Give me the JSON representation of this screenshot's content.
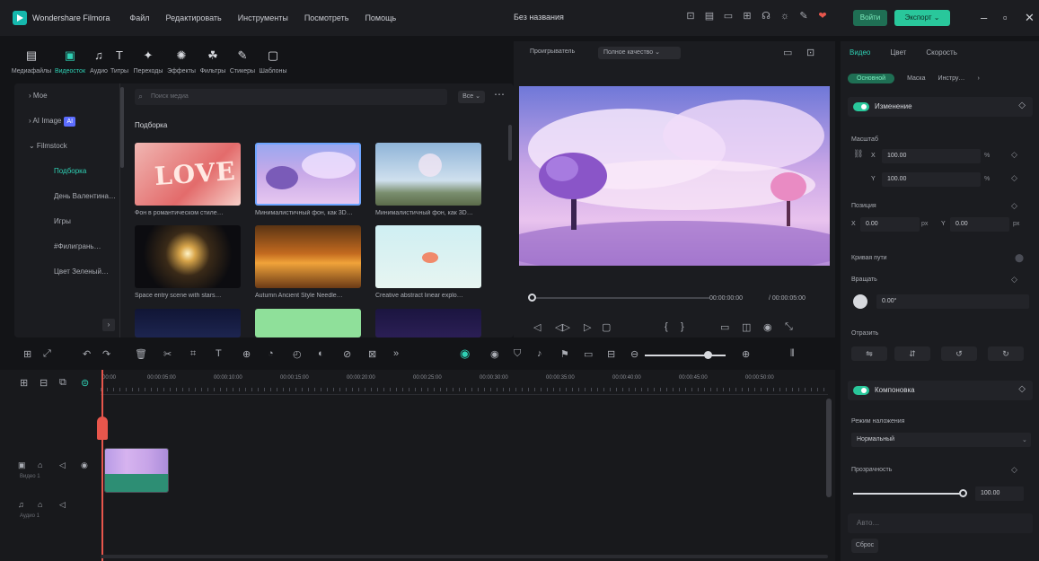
{
  "app": {
    "name": "Wondershare Filmora",
    "menu": [
      "Файл",
      "Редактировать",
      "Инструменты",
      "Посмотреть",
      "Помощь"
    ],
    "project_title": "Без названия",
    "login_label": "Войти",
    "export_label": "Экспорт ⌄",
    "toolbar_icons": [
      "monitor-icon",
      "save-icon",
      "screen-icon",
      "grid-icon",
      "headset-icon",
      "bulb-icon",
      "notes-icon"
    ],
    "window_controls": [
      "minimize-icon",
      "maximize-icon",
      "close-icon"
    ]
  },
  "library": {
    "tools": [
      {
        "icon": "▤",
        "name": "media",
        "label": "Медиафайлы"
      },
      {
        "icon": "▣",
        "name": "stock",
        "label": "Видеосток"
      },
      {
        "icon": "♫",
        "name": "audio",
        "label": "Аудио"
      },
      {
        "icon": "T",
        "name": "titles",
        "label": "Титры"
      },
      {
        "icon": "✦",
        "name": "transitions",
        "label": "Переходы"
      },
      {
        "icon": "✺",
        "name": "effects",
        "label": "Эффекты"
      },
      {
        "icon": "☘",
        "name": "filters",
        "label": "Фильтры"
      },
      {
        "icon": "✎",
        "name": "stickers",
        "label": "Стикеры"
      },
      {
        "icon": "▢",
        "name": "templates",
        "label": "Шаблоны"
      }
    ],
    "sidebar": [
      {
        "label": "› Мое",
        "kind": "top"
      },
      {
        "label": "› AI Image",
        "badge": "AI",
        "kind": "top"
      },
      {
        "label": "⌄ Filmstock",
        "kind": "top"
      },
      {
        "label": "Подборка",
        "kind": "active"
      },
      {
        "label": "День Валентина…",
        "kind": "sub"
      },
      {
        "label": "Игры",
        "kind": "sub"
      },
      {
        "label": "#Филигрань…",
        "kind": "sub"
      },
      {
        "label": "Цвет Зеленый…",
        "kind": "sub"
      }
    ],
    "search_placeholder": "Поиск медиа",
    "filter_label": "Все ⌄",
    "section_title": "Подборка",
    "thumbs": [
      {
        "caption": "Фон в романтическом стиле…"
      },
      {
        "caption": "Минималистичный фон, как 3D…"
      },
      {
        "caption": "Минималистичный фон, как 3D…"
      },
      {
        "caption": "Space entry scene with stars…"
      },
      {
        "caption": "Autumn Ancient Style Needle…"
      },
      {
        "caption": "Creative abstract linear explo…"
      },
      {
        "caption": ""
      },
      {
        "caption": ""
      },
      {
        "caption": ""
      }
    ]
  },
  "player": {
    "label": "Проигрыватель",
    "quality": "Полное качество ⌄",
    "time_current": "00:00:00:00",
    "time_total": "/ 00:00:05:00"
  },
  "props": {
    "tabs": [
      "Видео",
      "Цвет",
      "Скорость"
    ],
    "subtabs": [
      "Основной",
      "Маска",
      "Инстру…"
    ],
    "transform": {
      "title": "Изменение",
      "scale_label": "Масштаб",
      "scale_x": "100.00",
      "scale_y": "100.00",
      "scale_unit": "%",
      "position_label": "Позиция",
      "pos_x": "0.00",
      "pos_y": "0.00",
      "pos_unit": "px",
      "path_curve_label": "Кривая пути",
      "rotate_label": "Вращать",
      "rotate_value": "0.00°",
      "flip_label": "Отразить"
    },
    "compositing": {
      "title": "Компоновка",
      "blend_label": "Режим наложения",
      "blend_value": "Нормальный",
      "opacity_label": "Прозрачность",
      "opacity_value": "100.00",
      "opacity_level": 1.0
    },
    "collapsed_label": "Авто…",
    "reset_label": "Сброс"
  },
  "timeline": {
    "ruler": [
      "00:00",
      "00:00:05:00",
      "00:00:10:00",
      "00:00:15:00",
      "00:00:20:00",
      "00:00:25:00",
      "00:00:30:00",
      "00:00:35:00",
      "00:00:40:00",
      "00:00:45:00",
      "00:00:50:00",
      "00:00:55:00"
    ],
    "video_track_label": "Видео 1",
    "audio_track_label": "Аудио 1"
  }
}
